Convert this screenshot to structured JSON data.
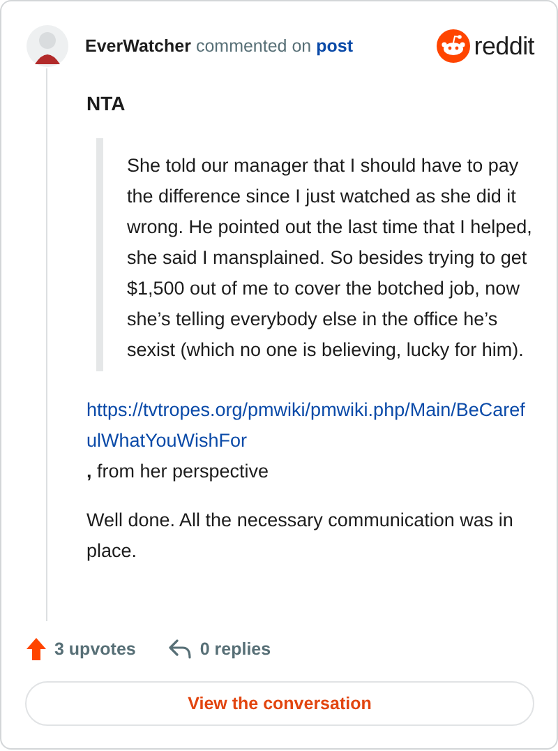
{
  "header": {
    "author": "EverWatcher",
    "action": "commented on",
    "target": "post"
  },
  "logo": {
    "text": "reddit"
  },
  "comment": [
    {
      "kind": "heading",
      "text": "NTA"
    },
    {
      "kind": "quote",
      "text": "She told our manager that I should have to pay the difference since I just watched as she did it wrong. He pointed out the last time that I helped, she said I mansplained. So besides trying to get $1,500 out of me to cover the botched job, now she’s telling everybody else in the office he’s sexist (which no one is believing, lucky for him)."
    },
    {
      "kind": "link",
      "link": "https://tvtropes.org/pmwiki/pmwiki.php/Main/BeCarefulWhatYouWishFor",
      "text": "**,** from her perspective"
    },
    {
      "kind": "text",
      "text": "Well done. All the necessary communication was in place."
    }
  ],
  "footer": {
    "upvotes": "3 upvotes",
    "replies": "0 replies",
    "button": "View the conversation"
  }
}
